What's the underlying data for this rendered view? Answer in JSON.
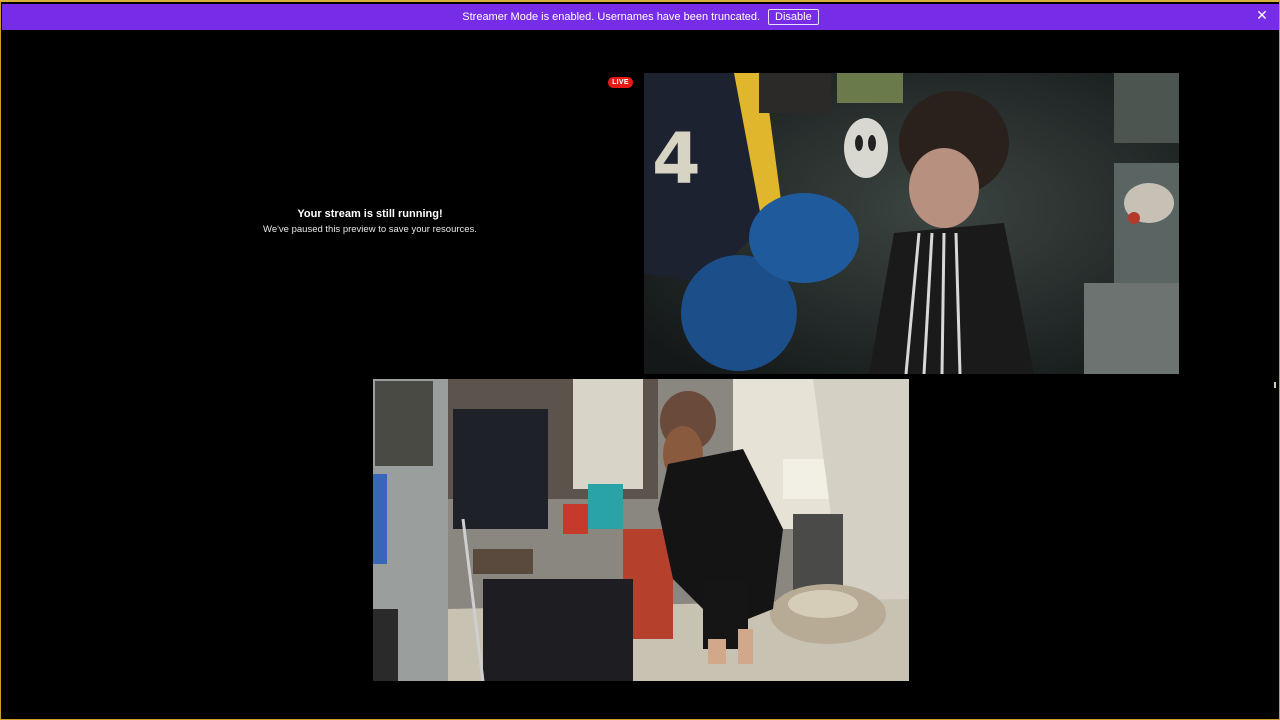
{
  "banner": {
    "text": "Streamer Mode is enabled. Usernames have been truncated.",
    "disable_label": "Disable",
    "close_icon": "close-icon",
    "color": "#772ce8"
  },
  "preview": {
    "title": "Your stream is still running!",
    "subtitle": "We've paused this preview to save your resources."
  },
  "live_badge": {
    "label": "LIVE",
    "color": "#e91916"
  },
  "webcams": [
    {
      "name": "top-right webcam feed"
    },
    {
      "name": "bottom webcam feed"
    }
  ]
}
